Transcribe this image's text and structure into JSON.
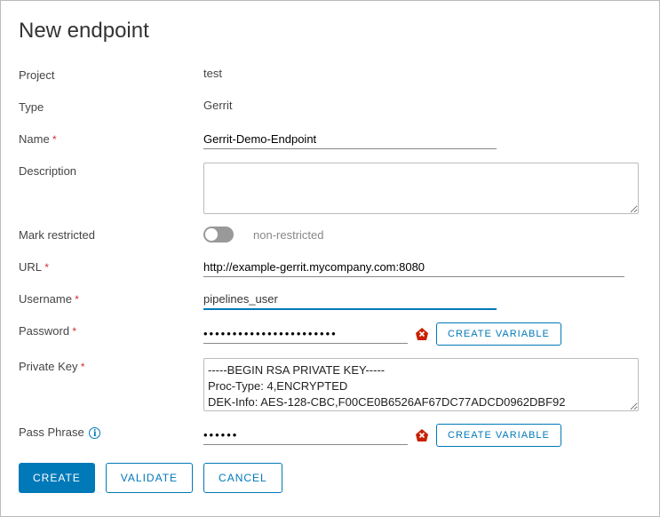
{
  "title": "New endpoint",
  "fields": {
    "project": {
      "label": "Project",
      "value": "test"
    },
    "type": {
      "label": "Type",
      "value": "Gerrit"
    },
    "name": {
      "label": "Name",
      "value": "Gerrit-Demo-Endpoint"
    },
    "description": {
      "label": "Description",
      "value": ""
    },
    "restricted": {
      "label": "Mark restricted",
      "status": "non-restricted"
    },
    "url": {
      "label": "URL",
      "value": "http://example-gerrit.mycompany.com:8080"
    },
    "username": {
      "label": "Username",
      "value": "pipelines_user"
    },
    "password": {
      "label": "Password",
      "value": "•••••••••••••••••••••••",
      "create_var": "CREATE VARIABLE"
    },
    "private_key": {
      "label": "Private Key",
      "value": "-----BEGIN RSA PRIVATE KEY-----\nProc-Type: 4,ENCRYPTED\nDEK-Info: AES-128-CBC,F00CE0B6526AF67DC77ADCD0962DBF92"
    },
    "passphrase": {
      "label": "Pass Phrase",
      "value": "••••••",
      "create_var": "CREATE VARIABLE"
    }
  },
  "buttons": {
    "create": "CREATE",
    "validate": "VALIDATE",
    "cancel": "CANCEL"
  }
}
